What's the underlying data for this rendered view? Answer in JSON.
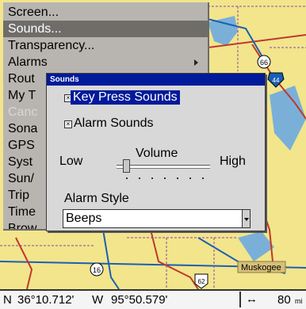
{
  "menu": {
    "items": [
      {
        "label": "Screen...",
        "state": "normal",
        "has_submenu": false
      },
      {
        "label": "Sounds...",
        "state": "selected",
        "has_submenu": false
      },
      {
        "label": "Transparency...",
        "state": "normal",
        "has_submenu": false
      },
      {
        "label": "Alarms",
        "state": "normal",
        "has_submenu": true
      },
      {
        "label": "Rout",
        "state": "normal",
        "has_submenu": false
      },
      {
        "label": "My T",
        "state": "normal",
        "has_submenu": false
      },
      {
        "label": "Canc",
        "state": "disabled",
        "has_submenu": false
      },
      {
        "label": "Sona",
        "state": "normal",
        "has_submenu": false
      },
      {
        "label": "GPS",
        "state": "normal",
        "has_submenu": false
      },
      {
        "label": "Syst",
        "state": "normal",
        "has_submenu": false
      },
      {
        "label": "Sun/",
        "state": "normal",
        "has_submenu": false
      },
      {
        "label": "Trip",
        "state": "normal",
        "has_submenu": false
      },
      {
        "label": "Time",
        "state": "normal",
        "has_submenu": false
      },
      {
        "label": "Brow",
        "state": "normal",
        "has_submenu": false
      }
    ]
  },
  "dialog": {
    "title": "Sounds",
    "key_press_sounds": {
      "label": "Key Press Sounds",
      "checked": true
    },
    "alarm_sounds": {
      "label": "Alarm Sounds",
      "checked": true
    },
    "volume": {
      "label": "Volume",
      "low_label": "Low",
      "high_label": "High",
      "level": 0.1
    },
    "alarm_style": {
      "label": "Alarm Style",
      "value": "Beeps"
    },
    "check_mark": "×"
  },
  "map": {
    "place_label": "Muskogee",
    "route_shields": [
      "66",
      "44",
      "16",
      "62"
    ]
  },
  "status_bar": {
    "lat_prefix": "N",
    "lat": "36°10.712'",
    "lon_prefix": "W",
    "lon": "95°50.579'",
    "scale_icon": "↔",
    "scale": "80",
    "scale_unit": "mi"
  },
  "colors": {
    "map_land": "#f2e58c",
    "menu_bg": "#b8b5b0",
    "selection": "#6f6d6a",
    "title_blue": "#001a9a"
  }
}
